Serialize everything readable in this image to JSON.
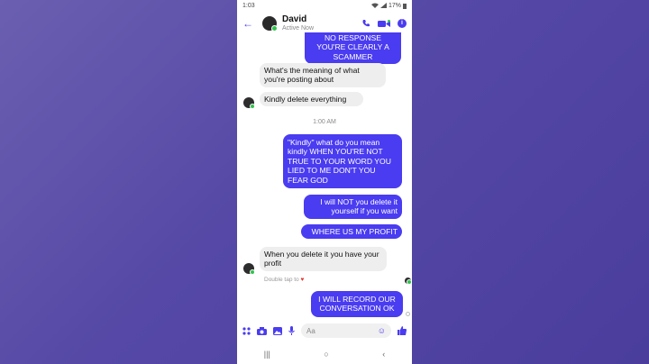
{
  "status_bar": {
    "time": "1:03",
    "battery": "17%"
  },
  "header": {
    "contact_name": "David",
    "contact_status": "Active Now"
  },
  "messages": [
    {
      "text": "NO RESPONSE YOU'RE CLEARLY A SCAMMER"
    },
    {
      "text": "What's the meaning of what you're posting about"
    },
    {
      "text": "Kindly delete everything"
    },
    {
      "text": "1:00 AM"
    },
    {
      "text": "\"Kindly\" what do you mean kindly WHEN YOU'RE NOT TRUE TO YOUR WORD YOU LIED TO ME DON'T YOU FEAR GOD"
    },
    {
      "text": "I will NOT you delete it yourself if you want"
    },
    {
      "text": "WHERE US MY PROFIT"
    },
    {
      "text": "When you delete it you have your profit"
    },
    {
      "text": "Double tap to"
    },
    {
      "text": "I WILL RECORD OUR CONVERSATION OK"
    }
  ],
  "composer": {
    "placeholder": "Aa"
  },
  "colors": {
    "accent": "#4a3cf0",
    "incoming_bubble": "#eeeeee",
    "online": "#31c24d"
  },
  "icons": [
    "back-arrow-icon",
    "phone-icon",
    "video-icon",
    "info-icon",
    "menu-grid-icon",
    "camera-icon",
    "gallery-icon",
    "mic-icon",
    "emoji-icon",
    "like-icon",
    "heart-icon"
  ]
}
